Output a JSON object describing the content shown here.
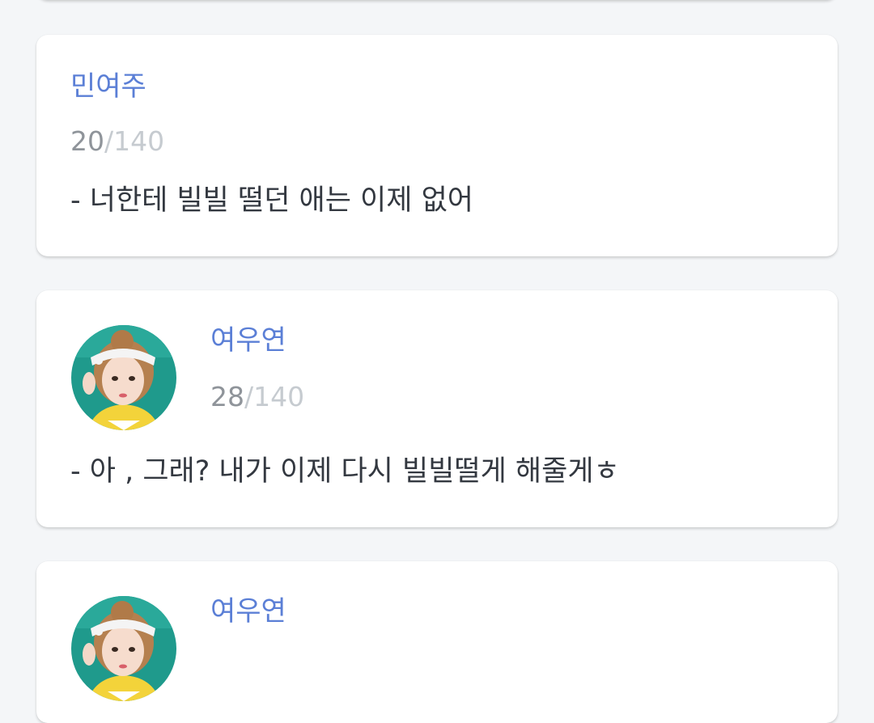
{
  "posts": [
    {
      "name": "민여주",
      "count_current": "20",
      "count_max": "/140",
      "message": "- 너한테 빌빌 떨던 애는 이제 없어",
      "has_avatar": false
    },
    {
      "name": "여우연",
      "count_current": "28",
      "count_max": "/140",
      "message": "- 아 , 그래? 내가 이제 다시 빌빌떨게 해줄게ㅎ",
      "has_avatar": true
    },
    {
      "name": "여우연",
      "has_avatar": true
    }
  ],
  "colors": {
    "background": "#f4f6f8",
    "card": "#ffffff",
    "name": "#5b7fd6",
    "count_current": "#8f949a",
    "count_max": "#c6cbd0",
    "message": "#333840",
    "avatar_bg": "#1f9a8c"
  }
}
